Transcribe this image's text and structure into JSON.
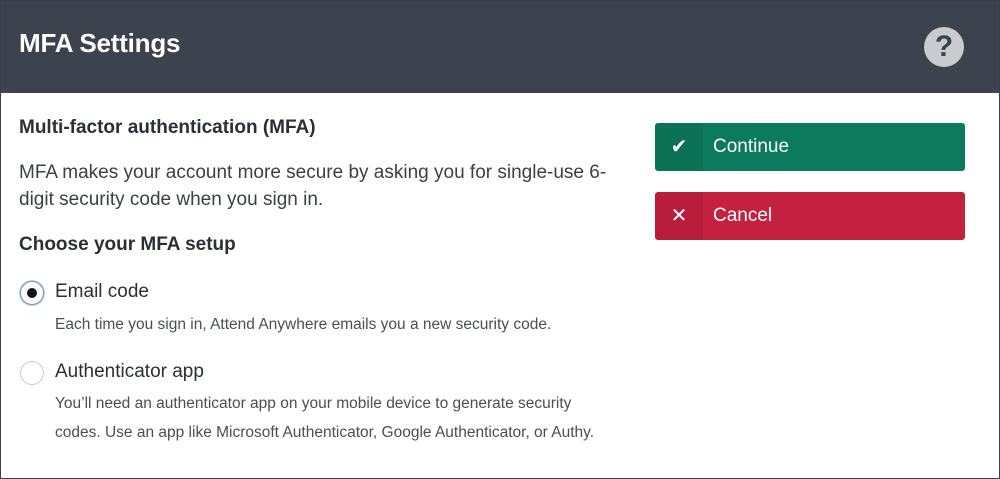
{
  "header": {
    "title": "MFA Settings",
    "help_icon": "question-mark-circle-icon"
  },
  "main": {
    "section_title": "Multi-factor authentication (MFA)",
    "intro": "MFA makes your account more secure by asking you for single-use 6-digit security code when you sign in.",
    "choose_title": "Choose your MFA setup",
    "options": [
      {
        "label": "Email code",
        "description": "Each time you sign in, Attend Anywhere emails you a new security code.",
        "selected": true
      },
      {
        "label": "Authenticator app",
        "description": "You’ll need an authenticator app on your mobile device to generate security codes. Use an app like Microsoft Authenticator, Google Authenticator, or Authy.",
        "selected": false
      }
    ]
  },
  "actions": {
    "continue_label": "Continue",
    "continue_icon": "checkmark-icon",
    "continue_color": "#0c7a5c",
    "cancel_label": "Cancel",
    "cancel_icon": "x-icon",
    "cancel_color": "#c4203f"
  },
  "colors": {
    "header_bg": "#3d434e",
    "accent": "#0c7a5c"
  }
}
